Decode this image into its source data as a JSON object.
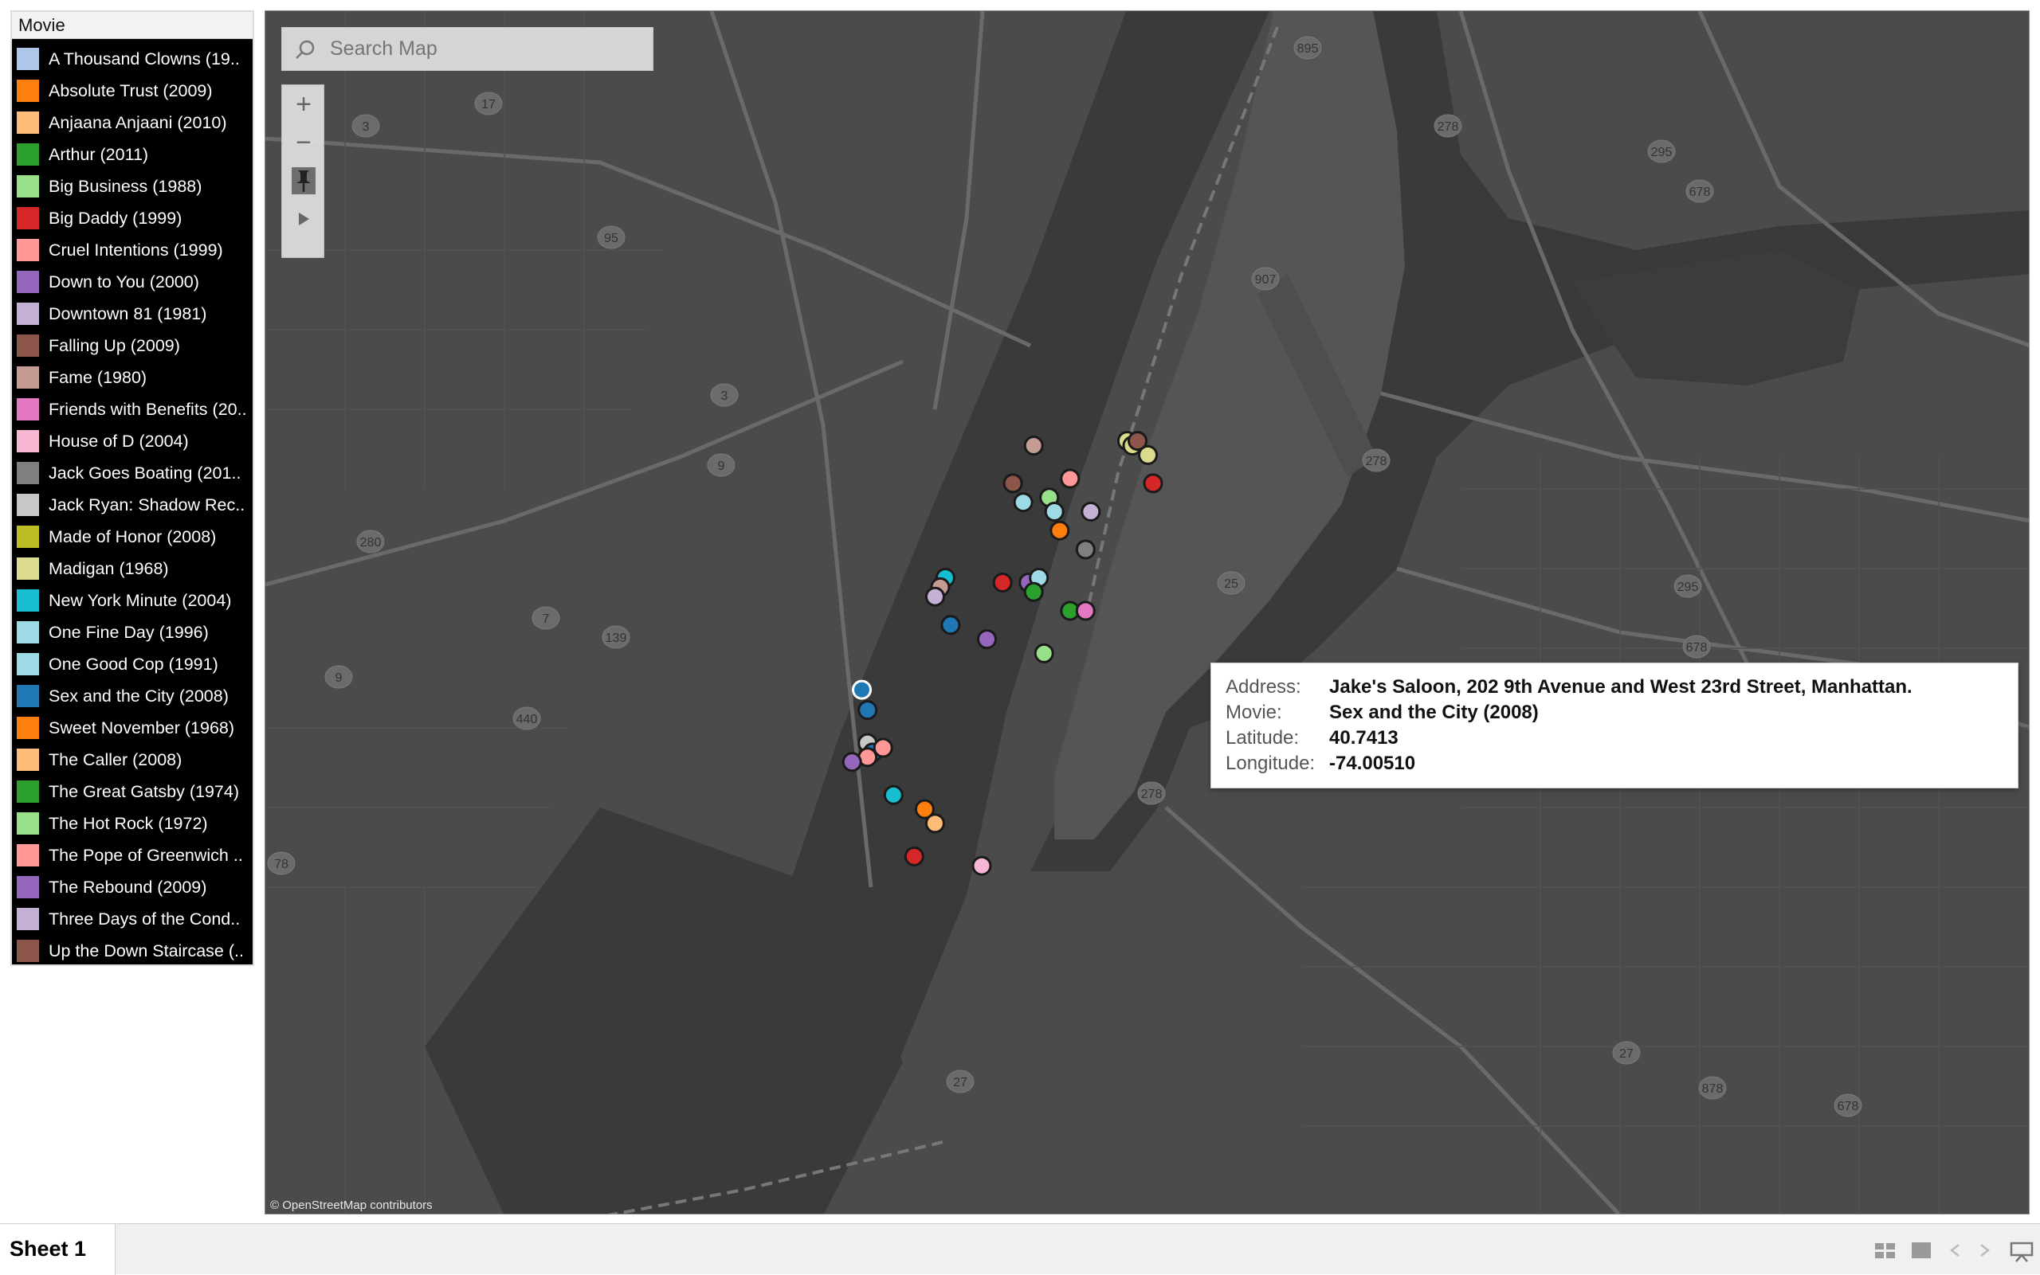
{
  "legend": {
    "title": "Movie",
    "items": [
      {
        "label": "A Thousand Clowns (19..",
        "color": "#aec7e8"
      },
      {
        "label": "Absolute Trust (2009)",
        "color": "#ff7f0e"
      },
      {
        "label": "Anjaana Anjaani (2010)",
        "color": "#ffbb78"
      },
      {
        "label": "Arthur (2011)",
        "color": "#2ca02c"
      },
      {
        "label": "Big Business (1988)",
        "color": "#98df8a"
      },
      {
        "label": "Big Daddy (1999)",
        "color": "#d62728"
      },
      {
        "label": "Cruel Intentions (1999)",
        "color": "#ff9896"
      },
      {
        "label": "Down to You (2000)",
        "color": "#9467bd"
      },
      {
        "label": "Downtown 81 (1981)",
        "color": "#c5b0d5"
      },
      {
        "label": "Falling Up (2009)",
        "color": "#8c564b"
      },
      {
        "label": "Fame (1980)",
        "color": "#c49c94"
      },
      {
        "label": "Friends with Benefits (20..",
        "color": "#e377c2"
      },
      {
        "label": "House of D (2004)",
        "color": "#f7b6d2"
      },
      {
        "label": "Jack Goes Boating (201..",
        "color": "#7f7f7f"
      },
      {
        "label": "Jack Ryan: Shadow Rec..",
        "color": "#c7c7c7"
      },
      {
        "label": "Made of Honor (2008)",
        "color": "#bcbd22"
      },
      {
        "label": "Madigan (1968)",
        "color": "#dbdb8d"
      },
      {
        "label": "New York Minute (2004)",
        "color": "#17becf"
      },
      {
        "label": "One Fine Day (1996)",
        "color": "#9edae5"
      },
      {
        "label": "One Good Cop (1991)",
        "color": "#9edae5"
      },
      {
        "label": "Sex and the City (2008)",
        "color": "#1f77b4"
      },
      {
        "label": "Sweet November (1968)",
        "color": "#ff7f0e"
      },
      {
        "label": "The Caller (2008)",
        "color": "#ffbb78"
      },
      {
        "label": "The Great Gatsby (1974)",
        "color": "#2ca02c"
      },
      {
        "label": "The Hot Rock (1972)",
        "color": "#98df8a"
      },
      {
        "label": "The Pope of Greenwich ..",
        "color": "#ff9896"
      },
      {
        "label": "The Rebound (2009)",
        "color": "#9467bd"
      },
      {
        "label": "Three Days of the Cond..",
        "color": "#c5b0d5"
      },
      {
        "label": "Up the Down Staircase (..",
        "color": "#8c564b"
      }
    ]
  },
  "map": {
    "search_placeholder": "Search Map",
    "attribution": "© OpenStreetMap contributors",
    "tools": {
      "zoom_in": "+",
      "zoom_out": "−",
      "pin": "pin-icon",
      "expand": "play-arrow-icon"
    },
    "road_shields": [
      "895",
      "17",
      "3",
      "95",
      "278",
      "295",
      "678",
      "907",
      "3",
      "9",
      "278",
      "280",
      "25",
      "295",
      "7",
      "139",
      "678",
      "9",
      "440",
      "278",
      "78",
      "27",
      "27",
      "878",
      "678"
    ]
  },
  "chart_data": {
    "type": "scatter",
    "x_unit": "longitude",
    "y_unit": "latitude",
    "series": [
      {
        "movie": "Sex and the City (2008)",
        "lon": -74.0051,
        "lat": 40.7413
      }
    ],
    "markers": [
      {
        "color": "#c49c94",
        "lon": -73.972,
        "lat": 40.793
      },
      {
        "color": "#8c564b",
        "lon": -73.976,
        "lat": 40.785
      },
      {
        "color": "#ff9896",
        "lon": -73.965,
        "lat": 40.786
      },
      {
        "color": "#98df8a",
        "lon": -73.969,
        "lat": 40.782
      },
      {
        "color": "#9edae5",
        "lon": -73.974,
        "lat": 40.781
      },
      {
        "color": "#9edae5",
        "lon": -73.968,
        "lat": 40.779
      },
      {
        "color": "#ff7f0e",
        "lon": -73.967,
        "lat": 40.775
      },
      {
        "color": "#c5b0d5",
        "lon": -73.961,
        "lat": 40.779
      },
      {
        "color": "#7f7f7f",
        "lon": -73.962,
        "lat": 40.771
      },
      {
        "color": "#dbdb8d",
        "lon": -73.954,
        "lat": 40.794
      },
      {
        "color": "#dbdb8d",
        "lon": -73.953,
        "lat": 40.793
      },
      {
        "color": "#8c564b",
        "lon": -73.952,
        "lat": 40.794
      },
      {
        "color": "#dbdb8d",
        "lon": -73.95,
        "lat": 40.791
      },
      {
        "color": "#d62728",
        "lon": -73.949,
        "lat": 40.785
      },
      {
        "color": "#17becf",
        "lon": -73.989,
        "lat": 40.765
      },
      {
        "color": "#c49c94",
        "lon": -73.99,
        "lat": 40.763
      },
      {
        "color": "#c5b0d5",
        "lon": -73.991,
        "lat": 40.761
      },
      {
        "color": "#d62728",
        "lon": -73.978,
        "lat": 40.764
      },
      {
        "color": "#9467bd",
        "lon": -73.973,
        "lat": 40.764
      },
      {
        "color": "#9edae5",
        "lon": -73.971,
        "lat": 40.765
      },
      {
        "color": "#2ca02c",
        "lon": -73.972,
        "lat": 40.762
      },
      {
        "color": "#2ca02c",
        "lon": -73.965,
        "lat": 40.758
      },
      {
        "color": "#e377c2",
        "lon": -73.962,
        "lat": 40.758
      },
      {
        "color": "#1f77b4",
        "lon": -73.988,
        "lat": 40.755
      },
      {
        "color": "#9467bd",
        "lon": -73.981,
        "lat": 40.752
      },
      {
        "color": "#98df8a",
        "lon": -73.97,
        "lat": 40.749
      },
      {
        "color": "#1f77b4",
        "lon": -74.0051,
        "lat": 40.7413,
        "highlight": true
      },
      {
        "color": "#1f77b4",
        "lon": -74.004,
        "lat": 40.737
      },
      {
        "color": "#c7c7c7",
        "lon": -74.004,
        "lat": 40.73
      },
      {
        "color": "#1f77b4",
        "lon": -74.003,
        "lat": 40.728
      },
      {
        "color": "#ff9896",
        "lon": -74.001,
        "lat": 40.729
      },
      {
        "color": "#ff9896",
        "lon": -74.004,
        "lat": 40.727
      },
      {
        "color": "#9467bd",
        "lon": -74.007,
        "lat": 40.726
      },
      {
        "color": "#17becf",
        "lon": -73.999,
        "lat": 40.719
      },
      {
        "color": "#ff7f0e",
        "lon": -73.993,
        "lat": 40.716
      },
      {
        "color": "#ffbb78",
        "lon": -73.991,
        "lat": 40.713
      },
      {
        "color": "#d62728",
        "lon": -73.995,
        "lat": 40.706
      },
      {
        "color": "#f7b6d2",
        "lon": -73.982,
        "lat": 40.704
      }
    ],
    "xlim": [
      -74.12,
      -73.78
    ],
    "ylim": [
      40.63,
      40.885
    ]
  },
  "tooltip": {
    "rows": [
      {
        "key": "Address:",
        "value": "Jake's Saloon, 202 9th Avenue and West 23rd Street, Manhattan."
      },
      {
        "key": "Movie:",
        "value": "Sex and the City (2008)"
      },
      {
        "key": "Latitude:",
        "value": "40.7413"
      },
      {
        "key": "Longitude:",
        "value": "-74.00510"
      }
    ]
  },
  "tabs": {
    "sheet_label": "Sheet 1",
    "controls": [
      "show-sheet-sorter-icon",
      "show-filmstrip-icon",
      "prev-sheet-icon",
      "next-sheet-icon",
      "presentation-mode-icon"
    ]
  }
}
